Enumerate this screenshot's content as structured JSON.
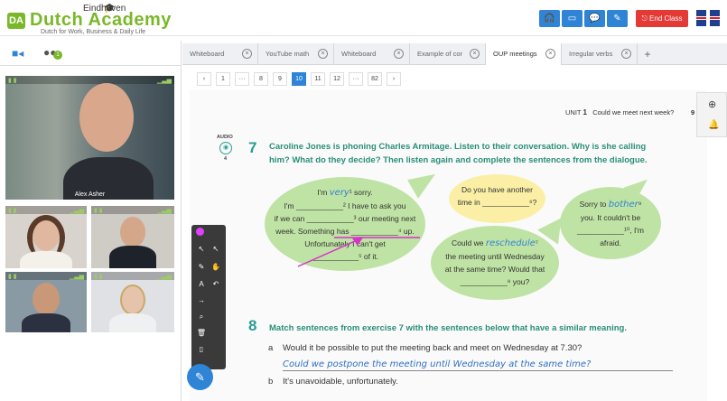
{
  "header": {
    "logo_city": "Eindhoven",
    "logo_main": "Dutch Academy",
    "logo_sub": "Dutch for Work, Business & Daily Life",
    "end_class": "End Class",
    "accent": "#2f84d6",
    "brand": "#7ab82a"
  },
  "left_panel": {
    "chat_badge": "1",
    "main_video_name": "Alex Asher"
  },
  "tabs": [
    {
      "label": "Whiteboard"
    },
    {
      "label": "YouTube math"
    },
    {
      "label": "Whiteboard"
    },
    {
      "label": "Example of cor"
    },
    {
      "label": "OUP meetings"
    },
    {
      "label": "Irregular verbs"
    }
  ],
  "active_tab": 4,
  "pager": {
    "pages": [
      "1",
      "···",
      "8",
      "9",
      "10",
      "11",
      "12",
      "···",
      "82"
    ],
    "active": "10"
  },
  "book": {
    "unit": "UNIT",
    "unit_num": "1",
    "unit_title": "Could we meet next week?",
    "page_number": "9",
    "audio_label": "AUDIO",
    "audio_num": "4",
    "ex7_num": "7",
    "ex7_line1": "Caroline Jones is phoning Charles Armitage. Listen to their conversation. Why is she calling",
    "ex7_line2": "him? What do they decide? Then listen again and complete the sentences from the dialogue.",
    "b1": {
      "l1a": "I'm ",
      "l1w": "very",
      "l1b": "¹ sorry.",
      "l2": "I'm ___________² I have to ask you",
      "l3": "if we can ___________³ our meeting next",
      "l4a": "week. Something has ",
      "l4b": "⁴ up.",
      "l5": "Unfortunately I can't get",
      "l6": "___________⁵ of it."
    },
    "b2": {
      "l1": "Do you have another",
      "l2": "time in ___________⁶?"
    },
    "b3": {
      "l1a": "Sorry to ",
      "l1w": "bother",
      "l1b": "⁹",
      "l2": "you. It couldn't be",
      "l3": "___________¹⁰, I'm",
      "l4": "afraid."
    },
    "b4": {
      "l1a": "Could we ",
      "l1w": "reschedule",
      "l1b": "⁷",
      "l2": "the meeting until Wednesday",
      "l3": "at the same time? Would that",
      "l4": "___________⁸ you?"
    },
    "ex8_num": "8",
    "ex8_text": "Match sentences from exercise 7 with the sentences below that have a similar meaning.",
    "qa_label": "a",
    "qa": "Would it be possible to put the meeting back and meet on Wednesday at 7.30?",
    "qa_answer": "Could we postpone the meeting until Wednesday at the same time?",
    "qb_label": "b",
    "qb": "It's unavoidable, unfortunately."
  }
}
